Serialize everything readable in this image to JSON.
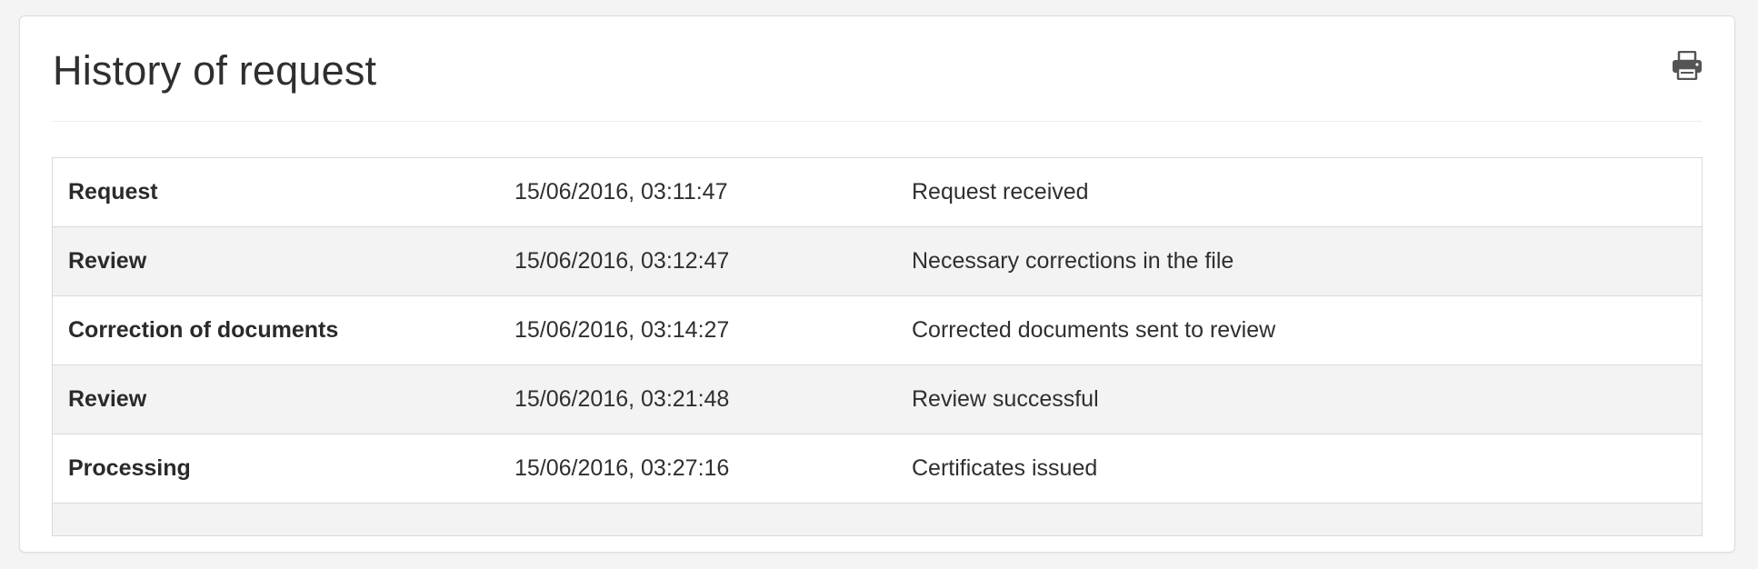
{
  "panel": {
    "title": "History of request",
    "print_icon": "printer-icon"
  },
  "history": {
    "rows": [
      {
        "step": "Request",
        "date": "15/06/2016, 03:11:47",
        "description": "Request received"
      },
      {
        "step": "Review",
        "date": "15/06/2016, 03:12:47",
        "description": "Necessary corrections in the file"
      },
      {
        "step": "Correction of documents",
        "date": "15/06/2016, 03:14:27",
        "description": "Corrected documents sent to review"
      },
      {
        "step": "Review",
        "date": "15/06/2016, 03:21:48",
        "description": "Review successful"
      },
      {
        "step": "Processing",
        "date": "15/06/2016, 03:27:16",
        "description": "Certificates issued"
      }
    ]
  },
  "colors": {
    "page_background": "#f4f4f4",
    "panel_background": "#ffffff",
    "striped_row": "#f3f3f3",
    "border": "#d9d9d9",
    "text": "#2b2b2b",
    "icon": "#555555"
  }
}
